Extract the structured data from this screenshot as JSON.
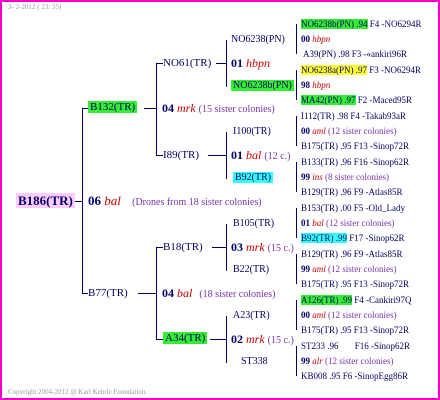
{
  "header_date": "3-  2-2012 ( 23: 35)",
  "copyright": "Copyright 2004-2012 @ Karl Kehrle Foundation.",
  "root": {
    "id": "B186(TR)",
    "year": "06",
    "breeder": "bal",
    "note": "(Drones from 18 sister colonies)"
  },
  "dam": {
    "id": "B132(TR)",
    "year": "04",
    "breeder": "mrk",
    "note": "(15 sister colonies)"
  },
  "sire": {
    "id": "B77(TR)",
    "year": "04",
    "breeder": "bal",
    "note": "(18 sister colonies)"
  },
  "dam_dam": {
    "id": "NO61(TR)",
    "year": "01",
    "breeder": "hbpn"
  },
  "dam_sire": {
    "id": "I89(TR)",
    "year": "01",
    "breeder": "bal",
    "note": "(12 c.)"
  },
  "sire_dam": {
    "id": "B18(TR)",
    "year": "03",
    "breeder": "mrk",
    "note": "(15 c.)"
  },
  "sire_sire": {
    "id": "A34(TR)",
    "year": "02",
    "breeder": "mrk",
    "note": "(15 c.)"
  },
  "gen3": [
    {
      "id": "NO6238(PN)",
      "year": "00",
      "breeder": "hbpn"
    },
    {
      "id": "NO6238b(PN)",
      "year": "98",
      "breeder": "hbpn"
    },
    {
      "id": "I100(TR)",
      "year": "00",
      "breeder": "aml",
      "note": "(12 sister colonies)"
    },
    {
      "id": "B92(TR)",
      "year": "99",
      "breeder": "ins",
      "note": "(8 sister colonies)"
    },
    {
      "id": "B105(TR)",
      "year": "01",
      "breeder": "bal",
      "note": "(12 sister colonies)"
    },
    {
      "id": "B22(TR)",
      "year": "99",
      "breeder": "aml",
      "note": "(12 sister colonies)"
    },
    {
      "id": "A23(TR)",
      "year": "00",
      "breeder": "aml",
      "note": "(12 sister colonies)"
    },
    {
      "id": "ST338",
      "year": "99",
      "breeder": "alr",
      "note": "(12 sister colonies)"
    }
  ],
  "gen4": [
    {
      "left": "NO6238b(PN) .94",
      "right": "F4 -NO6294R"
    },
    {
      "left": "A39(PN) .98",
      "right": "F3 -«ankiri96R"
    },
    {
      "left": "NO6238a(PN) .97",
      "right": "F3 -NO6294R"
    },
    {
      "left": "MA42(PN) .97",
      "right": "F2 -Maced95R"
    },
    {
      "left": "I112(TR) .98",
      "right": "F4 -Takab93aR"
    },
    {
      "left": "B175(TR) .95",
      "right": "F13 -Sinop72R"
    },
    {
      "left": "B133(TR) .96",
      "right": "F16 -Sinop62R"
    },
    {
      "left": "B129(TR) .96",
      "right": "F9 -Atlas85R"
    },
    {
      "left": "B153(TR) .00",
      "right": "F5 -Old_Lady"
    },
    {
      "left": "B92(TR) .99",
      "right": "F17 -Sinop62R"
    },
    {
      "left": "B129(TR) .96",
      "right": "F9 -Atlas85R"
    },
    {
      "left": "B175(TR) .95",
      "right": "F13 -Sinop72R"
    },
    {
      "left": "A126(TR) .99",
      "right": "F4 -Cankiri97Q"
    },
    {
      "left": "B175(TR) .95",
      "right": "F13 -Sinop72R"
    },
    {
      "left": "ST233 .96",
      "right": "F16 -Sinop62R"
    },
    {
      "left": "KB008 .95",
      "right": "F6 -SinopEgg86R"
    }
  ]
}
